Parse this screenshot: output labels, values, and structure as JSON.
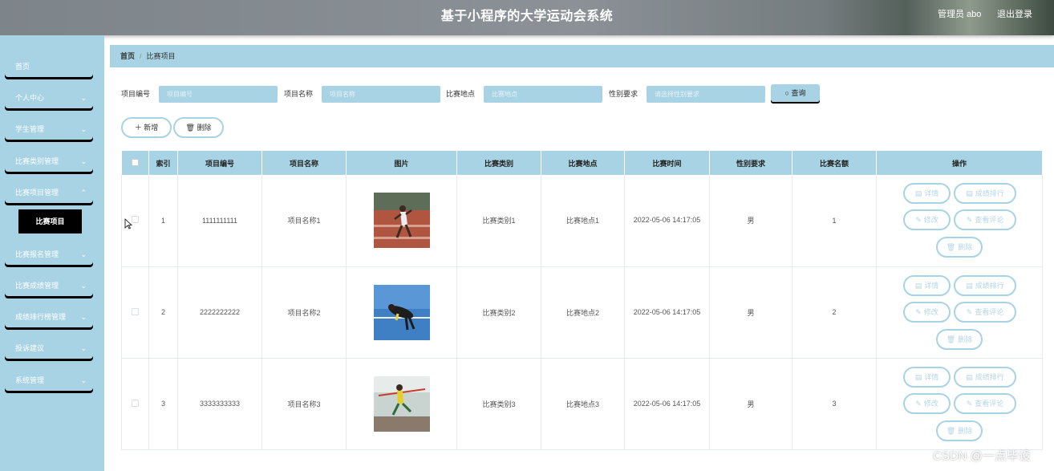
{
  "header": {
    "title": "基于小程序的大学运动会系统",
    "user": "管理员 abo",
    "logout": "退出登录"
  },
  "sidebar": {
    "items": [
      {
        "label": "首页",
        "has_chevron": false
      },
      {
        "label": "个人中心",
        "has_chevron": true
      },
      {
        "label": "学生管理",
        "has_chevron": true
      },
      {
        "label": "比赛类别管理",
        "has_chevron": true
      },
      {
        "label": "比赛项目管理",
        "has_chevron": true
      },
      {
        "label": "比赛报名管理",
        "has_chevron": true
      },
      {
        "label": "比赛成绩管理",
        "has_chevron": true
      },
      {
        "label": "成绩排行榜管理",
        "has_chevron": true
      },
      {
        "label": "投诉建议",
        "has_chevron": true
      },
      {
        "label": "系统管理",
        "has_chevron": true
      }
    ],
    "active_sub": "比赛项目"
  },
  "breadcrumb": {
    "home": "首页",
    "current": "比赛项目"
  },
  "search": {
    "fields": [
      {
        "label": "项目编号",
        "placeholder": "项目编号"
      },
      {
        "label": "项目名称",
        "placeholder": "项目名称"
      },
      {
        "label": "比赛地点",
        "placeholder": "比赛地点"
      },
      {
        "label": "性别要求",
        "placeholder": "请选择性别要求"
      }
    ],
    "query_label": "查询"
  },
  "actions": {
    "add": "新增",
    "delete": "删除"
  },
  "table": {
    "headers": [
      "索引",
      "项目编号",
      "项目名称",
      "图片",
      "比赛类别",
      "比赛地点",
      "比赛时间",
      "性别要求",
      "比赛名额",
      "操作"
    ],
    "rows": [
      {
        "index": "1",
        "code": "1111111111",
        "name": "项目名称1",
        "category": "比赛类别1",
        "place": "比赛地点1",
        "time": "2022-05-06 14:17:05",
        "gender": "男",
        "quota": "1"
      },
      {
        "index": "2",
        "code": "2222222222",
        "name": "项目名称2",
        "category": "比赛类别2",
        "place": "比赛地点2",
        "time": "2022-05-06 14:17:05",
        "gender": "男",
        "quota": "2"
      },
      {
        "index": "3",
        "code": "3333333333",
        "name": "项目名称3",
        "category": "比赛类别3",
        "place": "比赛地点3",
        "time": "2022-05-06 14:17:05",
        "gender": "男",
        "quota": "3"
      }
    ],
    "row_actions": {
      "detail": "详情",
      "rank": "成绩排行",
      "edit": "修改",
      "review": "查看评论",
      "delete": "删除"
    }
  },
  "watermark": "CSDN @一点毕设",
  "colors": {
    "accent": "#a8d3e4",
    "header_bg": "#868c91"
  }
}
